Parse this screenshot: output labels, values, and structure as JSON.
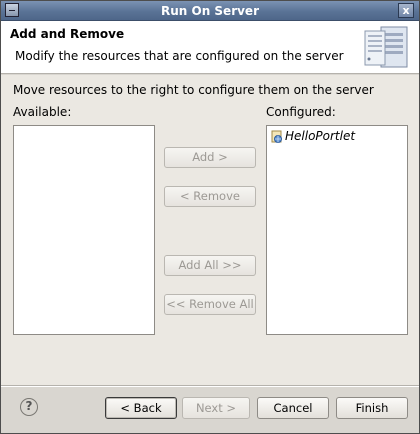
{
  "window": {
    "title": "Run On Server",
    "close_glyph": "x"
  },
  "header": {
    "title": "Add and Remove",
    "description": "Modify the resources that are configured on the server",
    "icon": "server-icon"
  },
  "instruction": "Move resources to the right to configure them on the server",
  "available": {
    "label": "Available:",
    "items": []
  },
  "configured": {
    "label": "Configured:",
    "items": [
      {
        "label": "HelloPortlet",
        "icon": "web-project-icon"
      }
    ]
  },
  "actions": {
    "add": "Add >",
    "remove": "< Remove",
    "add_all": "Add All >>",
    "remove_all": "<< Remove All"
  },
  "footer": {
    "help_glyph": "?",
    "back": "< Back",
    "next": "Next >",
    "cancel": "Cancel",
    "finish": "Finish"
  }
}
